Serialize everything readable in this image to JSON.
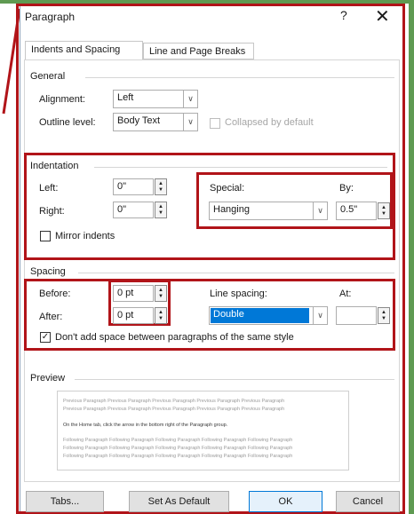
{
  "dialog": {
    "title": "Paragraph",
    "help_glyph": "?",
    "close_glyph": "✕"
  },
  "tabs": [
    {
      "label": "Indents and Spacing",
      "active": true
    },
    {
      "label": "Line and Page Breaks",
      "active": false
    }
  ],
  "general": {
    "header": "General",
    "alignment_label": "Alignment:",
    "alignment_value": "Left",
    "outline_label": "Outline level:",
    "outline_value": "Body Text",
    "collapsed_label": "Collapsed by default"
  },
  "indentation": {
    "header": "Indentation",
    "left_label": "Left:",
    "left_value": "0\"",
    "right_label": "Right:",
    "right_value": "0\"",
    "special_label": "Special:",
    "special_value": "Hanging",
    "by_label": "By:",
    "by_value": "0.5\"",
    "mirror_label": "Mirror indents"
  },
  "spacing": {
    "header": "Spacing",
    "before_label": "Before:",
    "before_value": "0 pt",
    "after_label": "After:",
    "after_value": "0 pt",
    "line_spacing_label": "Line spacing:",
    "line_spacing_value": "Double",
    "at_label": "At:",
    "at_value": "",
    "dont_add_label": "Don't add space between paragraphs of the same style",
    "dont_add_checked_glyph": "✓"
  },
  "preview": {
    "header": "Preview",
    "prev_lines": [
      "Previous Paragraph Previous Paragraph Previous Paragraph Previous Paragraph Previous Paragraph",
      "Previous Paragraph Previous Paragraph Previous Paragraph Previous Paragraph Previous Paragraph"
    ],
    "main_line": "On the Home tab, click the arrow in the bottom right of the Paragraph group.",
    "follow_lines": [
      "Following Paragraph Following Paragraph Following Paragraph Following Paragraph Following Paragraph",
      "Following Paragraph Following Paragraph Following Paragraph Following Paragraph Following Paragraph",
      "Following Paragraph Following Paragraph Following Paragraph Following Paragraph Following Paragraph"
    ]
  },
  "buttons": {
    "tabs": "Tabs...",
    "set_default": "Set As Default",
    "ok": "OK",
    "cancel": "Cancel"
  },
  "colors": {
    "highlight_red": "#b11419",
    "accent_green": "#5f9a52",
    "selection_blue": "#0078d7"
  }
}
